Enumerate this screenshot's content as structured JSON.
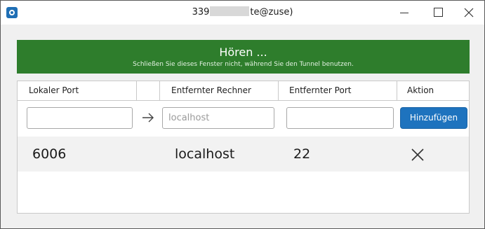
{
  "window": {
    "title_prefix": "339",
    "title_suffix": "te@zuse)",
    "icons": {
      "app": "app-icon",
      "minimize": "minimize-icon",
      "maximize": "maximize-icon",
      "close": "close-icon"
    }
  },
  "banner": {
    "title": "Hören ...",
    "subtitle": "Schließen Sie dieses Fenster nicht, während Sie den Tunnel benutzen.",
    "color": "#2e7d2c"
  },
  "table": {
    "headers": [
      "Lokaler Port",
      "",
      "Entfernter Rechner",
      "Entfernter Port",
      "Aktion"
    ],
    "form": {
      "local_port_value": "",
      "remote_host_placeholder": "localhost",
      "remote_port_value": "",
      "arrow_icon": "arrow-right-icon",
      "add_button_label": "Hinzufügen",
      "accent": "#1e73be"
    },
    "rows": [
      {
        "local_port": "6006",
        "remote_host": "localhost",
        "remote_port": "22",
        "action_icon": "delete-x-icon"
      }
    ]
  }
}
